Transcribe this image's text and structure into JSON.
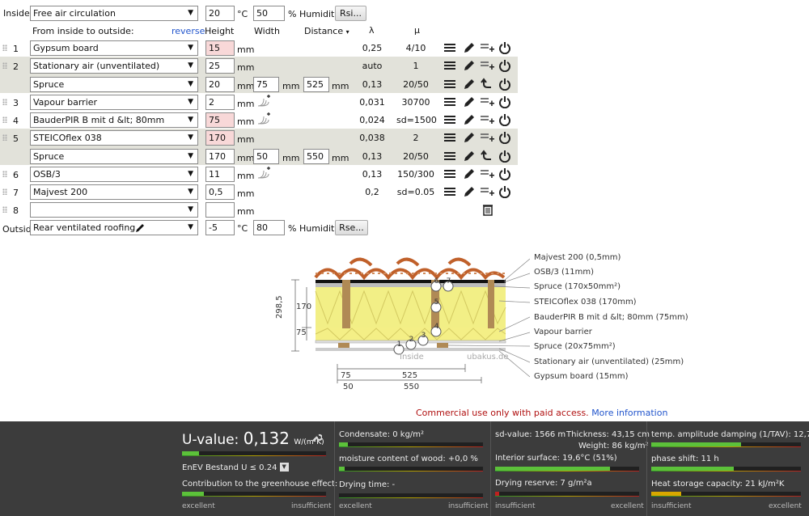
{
  "inside": {
    "label": "Inside:",
    "condition": "Free air circulation",
    "temp": "20",
    "temp_unit": "°C",
    "humidity": "50",
    "humidity_label": "% Humidity",
    "button": "Rsi..."
  },
  "outside": {
    "label": "Outside",
    "condition": "Rear ventilated roofing",
    "temp": "-5",
    "temp_unit": "°C",
    "humidity": "80",
    "humidity_label": "% Humidity",
    "button": "Rse..."
  },
  "headers": {
    "from": "From inside to outside:",
    "reverse": "reverse",
    "height": "Height",
    "width": "Width",
    "distance": "Distance",
    "distance_arrow": "▾",
    "lambda": "λ",
    "mu": "μ"
  },
  "unit_mm": "mm",
  "layers": [
    {
      "no": "1",
      "name": "Gypsum board",
      "height": "15",
      "lambda": "0,25",
      "mu": "4/10"
    },
    {
      "no": "2",
      "name": "Stationary air (unventilated)",
      "height": "25",
      "lambda": "auto",
      "mu": "1"
    },
    {
      "no": "",
      "name": "Spruce",
      "height": "20",
      "width": "75",
      "distance": "525",
      "lambda": "0,13",
      "mu": "20/50"
    },
    {
      "no": "3",
      "name": "Vapour barrier",
      "height": "2",
      "lambda": "0,031",
      "mu": "30700"
    },
    {
      "no": "4",
      "name": "BauderPIR B mit d &lt; 80mm",
      "height": "75",
      "lambda": "0,024",
      "mu": "sd=1500"
    },
    {
      "no": "5",
      "name": "STEICOflex 038",
      "height": "170",
      "lambda": "0,038",
      "mu": "2"
    },
    {
      "no": "",
      "name": "Spruce",
      "height": "170",
      "width": "50",
      "distance": "550",
      "lambda": "0,13",
      "mu": "20/50"
    },
    {
      "no": "6",
      "name": "OSB/3",
      "height": "11",
      "lambda": "0,13",
      "mu": "150/300"
    },
    {
      "no": "7",
      "name": "Majvest 200",
      "height": "0,5",
      "lambda": "0,2",
      "mu": "sd=0.05"
    },
    {
      "no": "8",
      "name": "",
      "height": "",
      "lambda": "",
      "mu": ""
    }
  ],
  "diagram": {
    "labels": [
      "Majvest 200 (0,5mm)",
      "OSB/3 (11mm)",
      "Spruce (170x50mm²)",
      "STEICOflex 038 (170mm)",
      "BauderPIR B mit d &lt; 80mm (75mm)",
      "Vapour barrier",
      "Spruce (20x75mm²)",
      "Stationary air (unventilated) (25mm)",
      "Gypsum board (15mm)"
    ],
    "inside": "Inside",
    "watermark": "ubakus.de",
    "dim_total": "298,5",
    "dim_170": "170",
    "dim_75": "75",
    "dim_w1": "75",
    "dim_w2": "50",
    "dim_d1": "525",
    "dim_d2": "550",
    "circles": [
      "1",
      "2",
      "3",
      "4",
      "5",
      "6",
      "7"
    ]
  },
  "notice": {
    "text": "Commercial use only with paid access.",
    "link": "More information"
  },
  "results": {
    "uvalue_label": "U-value:",
    "uvalue": "0,132",
    "uvalue_unit": "W/(m²K)",
    "enev": "EnEV Bestand U ≤ 0.24",
    "greenhouse": "Contribution to the greenhouse effect:",
    "condensate": "Condensate: 0 kg/m²",
    "moisture": "moisture content of wood: +0,0 %",
    "drying": "Drying time: -",
    "sd": "sd-value: 1566 m",
    "thickness": "Thickness: 43,15 cm",
    "weight": "Weight: 86 kg/m²",
    "interior": "Interior surface: 19,6°C (51%)",
    "reserve": "Drying reserve: 7 g/m²a",
    "tav": "temp. amplitude damping (1/TAV): 12,7",
    "phase": "phase shift: 11 h",
    "heat": "Heat storage capacity: 21 kJ/m²K",
    "excellent": "excellent",
    "insufficient": "insufficient",
    "bars": {
      "uvalue": 0.12,
      "enev": 0.12,
      "greenhouse": 0.15,
      "condensate": 0.06,
      "moisture": 0.04,
      "drying": 0.0,
      "sd": 0.0,
      "interior": 0.8,
      "reserve": 0.03,
      "tav": 0.6,
      "phase": 0.55,
      "heat": 0.2
    }
  },
  "colors": {
    "accent": "#2255cc",
    "pink": "#f8d8d8",
    "row": "#e2e2da",
    "dark": "#3c3c3c",
    "good": "#5cc13a",
    "warn": "#d8a800",
    "bad": "#c02020"
  }
}
